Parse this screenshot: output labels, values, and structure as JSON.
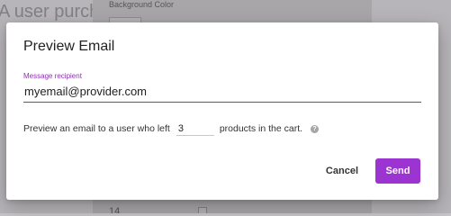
{
  "background": {
    "partial_text": "A user purcha",
    "panel_label": "Background Color",
    "bottom_number": "14"
  },
  "dialog": {
    "title": "Preview Email",
    "recipient": {
      "label": "Message recipient",
      "value": "myemail@provider.com"
    },
    "preview_sentence": {
      "before": "Preview an email to a user who left",
      "quantity": "3",
      "after": "products in the cart."
    },
    "help_icon_glyph": "?",
    "cancel_label": "Cancel",
    "send_label": "Send"
  },
  "colors": {
    "accent": "#9b34d1",
    "field_underline": "#8e2fb6"
  },
  "icons": {
    "help": "help-circle-icon"
  }
}
